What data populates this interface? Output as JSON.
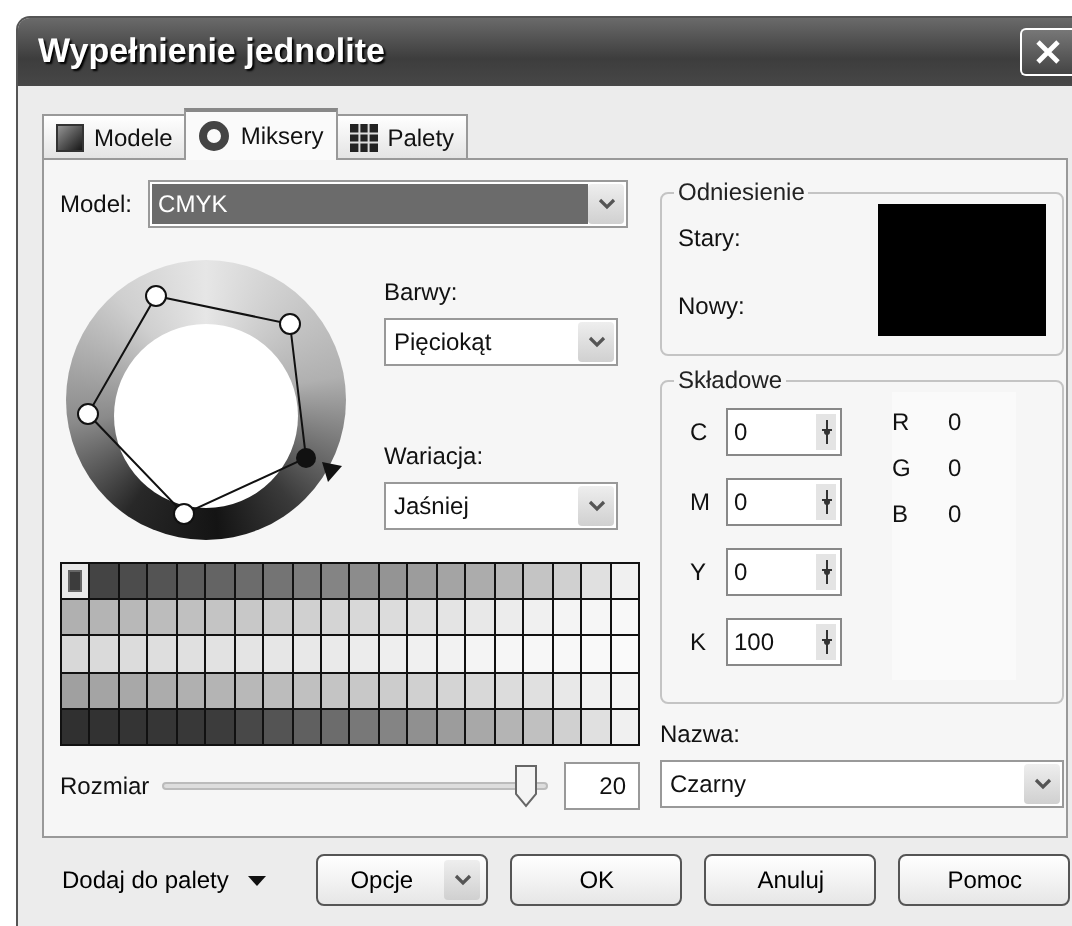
{
  "window": {
    "title": "Wypełnienie jednolite"
  },
  "tabs": [
    {
      "label": "Modele",
      "kind": "models",
      "selected": false
    },
    {
      "label": "Miksery",
      "kind": "mixers",
      "selected": true
    },
    {
      "label": "Palety",
      "kind": "palettes",
      "selected": false
    }
  ],
  "model": {
    "label": "Model:",
    "value": "CMYK"
  },
  "harmony": {
    "label": "Barwy:",
    "value": "Pięciokąt"
  },
  "variation": {
    "label": "Wariacja:",
    "value": "Jaśniej"
  },
  "palette": {
    "rows": [
      {
        "swatches": [
          {
            "color": "#3c3c3c",
            "selected": true
          },
          {
            "color": "#444444",
            "selected": false
          },
          {
            "color": "#4c4c4c",
            "selected": false
          },
          {
            "color": "#545454",
            "selected": false
          },
          {
            "color": "#5c5c5c",
            "selected": false
          },
          {
            "color": "#646464",
            "selected": false
          },
          {
            "color": "#6c6c6c",
            "selected": false
          },
          {
            "color": "#747474",
            "selected": false
          },
          {
            "color": "#7c7c7c",
            "selected": false
          },
          {
            "color": "#848484",
            "selected": false
          },
          {
            "color": "#8c8c8c",
            "selected": false
          },
          {
            "color": "#949494",
            "selected": false
          },
          {
            "color": "#9c9c9c",
            "selected": false
          },
          {
            "color": "#a4a4a4",
            "selected": false
          },
          {
            "color": "#acacac",
            "selected": false
          },
          {
            "color": "#b8b8b8",
            "selected": false
          },
          {
            "color": "#c4c4c4",
            "selected": false
          },
          {
            "color": "#d0d0d0",
            "selected": false
          },
          {
            "color": "#e0e0e0",
            "selected": false
          },
          {
            "color": "#f0f0f0",
            "selected": false
          }
        ]
      },
      {
        "swatches": [
          {
            "color": "#b0b0b0",
            "selected": false
          },
          {
            "color": "#b4b4b4",
            "selected": false
          },
          {
            "color": "#b8b8b8",
            "selected": false
          },
          {
            "color": "#bcbcbc",
            "selected": false
          },
          {
            "color": "#c0c0c0",
            "selected": false
          },
          {
            "color": "#c4c4c4",
            "selected": false
          },
          {
            "color": "#c8c8c8",
            "selected": false
          },
          {
            "color": "#cccccc",
            "selected": false
          },
          {
            "color": "#d0d0d0",
            "selected": false
          },
          {
            "color": "#d4d4d4",
            "selected": false
          },
          {
            "color": "#d8d8d8",
            "selected": false
          },
          {
            "color": "#dcdcdc",
            "selected": false
          },
          {
            "color": "#e0e0e0",
            "selected": false
          },
          {
            "color": "#e4e4e4",
            "selected": false
          },
          {
            "color": "#e8e8e8",
            "selected": false
          },
          {
            "color": "#ececec",
            "selected": false
          },
          {
            "color": "#f0f0f0",
            "selected": false
          },
          {
            "color": "#f4f4f4",
            "selected": false
          },
          {
            "color": "#f6f6f6",
            "selected": false
          },
          {
            "color": "#f8f8f8",
            "selected": false
          }
        ]
      },
      {
        "swatches": [
          {
            "color": "#d8d8d8",
            "selected": false
          },
          {
            "color": "#dadada",
            "selected": false
          },
          {
            "color": "#dcdcdc",
            "selected": false
          },
          {
            "color": "#dedede",
            "selected": false
          },
          {
            "color": "#e0e0e0",
            "selected": false
          },
          {
            "color": "#e2e2e2",
            "selected": false
          },
          {
            "color": "#e4e4e4",
            "selected": false
          },
          {
            "color": "#e6e6e6",
            "selected": false
          },
          {
            "color": "#e8e8e8",
            "selected": false
          },
          {
            "color": "#eaeaea",
            "selected": false
          },
          {
            "color": "#ececec",
            "selected": false
          },
          {
            "color": "#eeeeee",
            "selected": false
          },
          {
            "color": "#f0f0f0",
            "selected": false
          },
          {
            "color": "#f2f2f2",
            "selected": false
          },
          {
            "color": "#f4f4f4",
            "selected": false
          },
          {
            "color": "#f6f6f6",
            "selected": false
          },
          {
            "color": "#f7f7f7",
            "selected": false
          },
          {
            "color": "#f8f8f8",
            "selected": false
          },
          {
            "color": "#f9f9f9",
            "selected": false
          },
          {
            "color": "#fafafa",
            "selected": false
          }
        ]
      },
      {
        "swatches": [
          {
            "color": "#a0a0a0",
            "selected": false
          },
          {
            "color": "#a4a4a4",
            "selected": false
          },
          {
            "color": "#a8a8a8",
            "selected": false
          },
          {
            "color": "#acacac",
            "selected": false
          },
          {
            "color": "#b0b0b0",
            "selected": false
          },
          {
            "color": "#b4b4b4",
            "selected": false
          },
          {
            "color": "#b8b8b8",
            "selected": false
          },
          {
            "color": "#bcbcbc",
            "selected": false
          },
          {
            "color": "#c0c0c0",
            "selected": false
          },
          {
            "color": "#c4c4c4",
            "selected": false
          },
          {
            "color": "#c8c8c8",
            "selected": false
          },
          {
            "color": "#cccccc",
            "selected": false
          },
          {
            "color": "#d0d0d0",
            "selected": false
          },
          {
            "color": "#d4d4d4",
            "selected": false
          },
          {
            "color": "#d8d8d8",
            "selected": false
          },
          {
            "color": "#dcdcdc",
            "selected": false
          },
          {
            "color": "#e0e0e0",
            "selected": false
          },
          {
            "color": "#e8e8e8",
            "selected": false
          },
          {
            "color": "#f0f0f0",
            "selected": false
          },
          {
            "color": "#f4f4f4",
            "selected": false
          }
        ]
      },
      {
        "swatches": [
          {
            "color": "#303030",
            "selected": false
          },
          {
            "color": "#323232",
            "selected": false
          },
          {
            "color": "#343434",
            "selected": false
          },
          {
            "color": "#363636",
            "selected": false
          },
          {
            "color": "#383838",
            "selected": false
          },
          {
            "color": "#3c3c3c",
            "selected": false
          },
          {
            "color": "#484848",
            "selected": false
          },
          {
            "color": "#545454",
            "selected": false
          },
          {
            "color": "#606060",
            "selected": false
          },
          {
            "color": "#6c6c6c",
            "selected": false
          },
          {
            "color": "#787878",
            "selected": false
          },
          {
            "color": "#848484",
            "selected": false
          },
          {
            "color": "#909090",
            "selected": false
          },
          {
            "color": "#9c9c9c",
            "selected": false
          },
          {
            "color": "#a8a8a8",
            "selected": false
          },
          {
            "color": "#b4b4b4",
            "selected": false
          },
          {
            "color": "#c0c0c0",
            "selected": false
          },
          {
            "color": "#d0d0d0",
            "selected": false
          },
          {
            "color": "#e0e0e0",
            "selected": false
          },
          {
            "color": "#f0f0f0",
            "selected": false
          }
        ]
      }
    ]
  },
  "size": {
    "label": "Rozmiar",
    "level": 0.95,
    "value": "20"
  },
  "reference": {
    "title": "Odniesienie",
    "old_label": "Stary:",
    "new_label": "Nowy:",
    "color": "#000000"
  },
  "components": {
    "title": "Składowe",
    "cmyk": [
      {
        "label": "C",
        "value": "0"
      },
      {
        "label": "M",
        "value": "0"
      },
      {
        "label": "Y",
        "value": "0"
      },
      {
        "label": "K",
        "value": "100"
      }
    ],
    "rgb": [
      {
        "label": "R",
        "value": "0"
      },
      {
        "label": "G",
        "value": "0"
      },
      {
        "label": "B",
        "value": "0"
      }
    ]
  },
  "name": {
    "label": "Nazwa:",
    "value": "Czarny"
  },
  "buttons": [
    {
      "label": "Dodaj do palety",
      "kind": "menu"
    },
    {
      "label": "Opcje",
      "kind": "split"
    },
    {
      "label": "OK",
      "kind": "push"
    },
    {
      "label": "Anuluj",
      "kind": "push"
    },
    {
      "label": "Pomoc",
      "kind": "push"
    }
  ]
}
